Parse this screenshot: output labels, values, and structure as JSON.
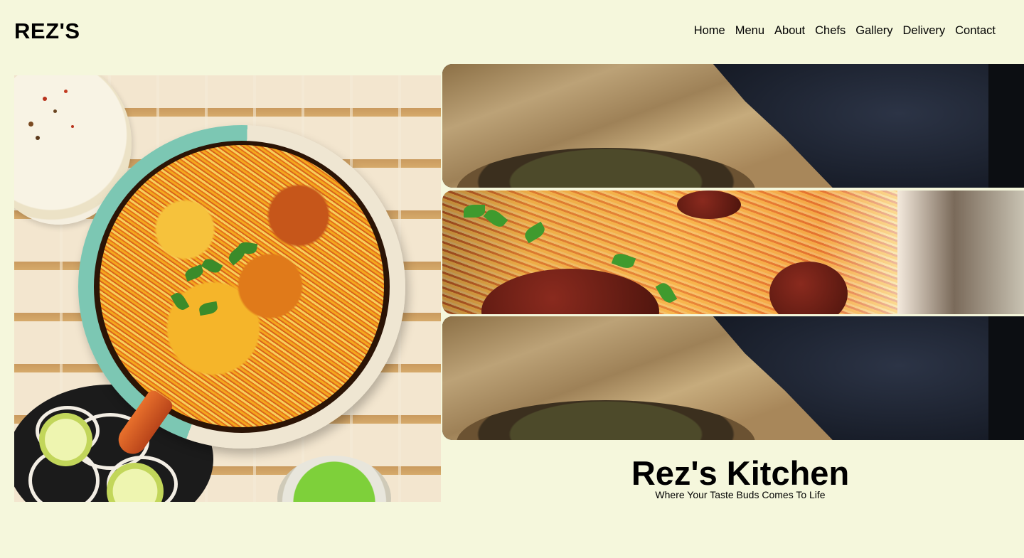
{
  "header": {
    "logo": "REZ'S",
    "nav": [
      "Home",
      "Menu",
      "About",
      "Chefs",
      "Gallery",
      "Delivery",
      "Contact"
    ]
  },
  "hero": {
    "title": "Rez's Kitchen",
    "tagline": "Where Your Taste Buds Comes To Life"
  },
  "colors": {
    "background": "#f5f7dc",
    "text": "#000000"
  }
}
